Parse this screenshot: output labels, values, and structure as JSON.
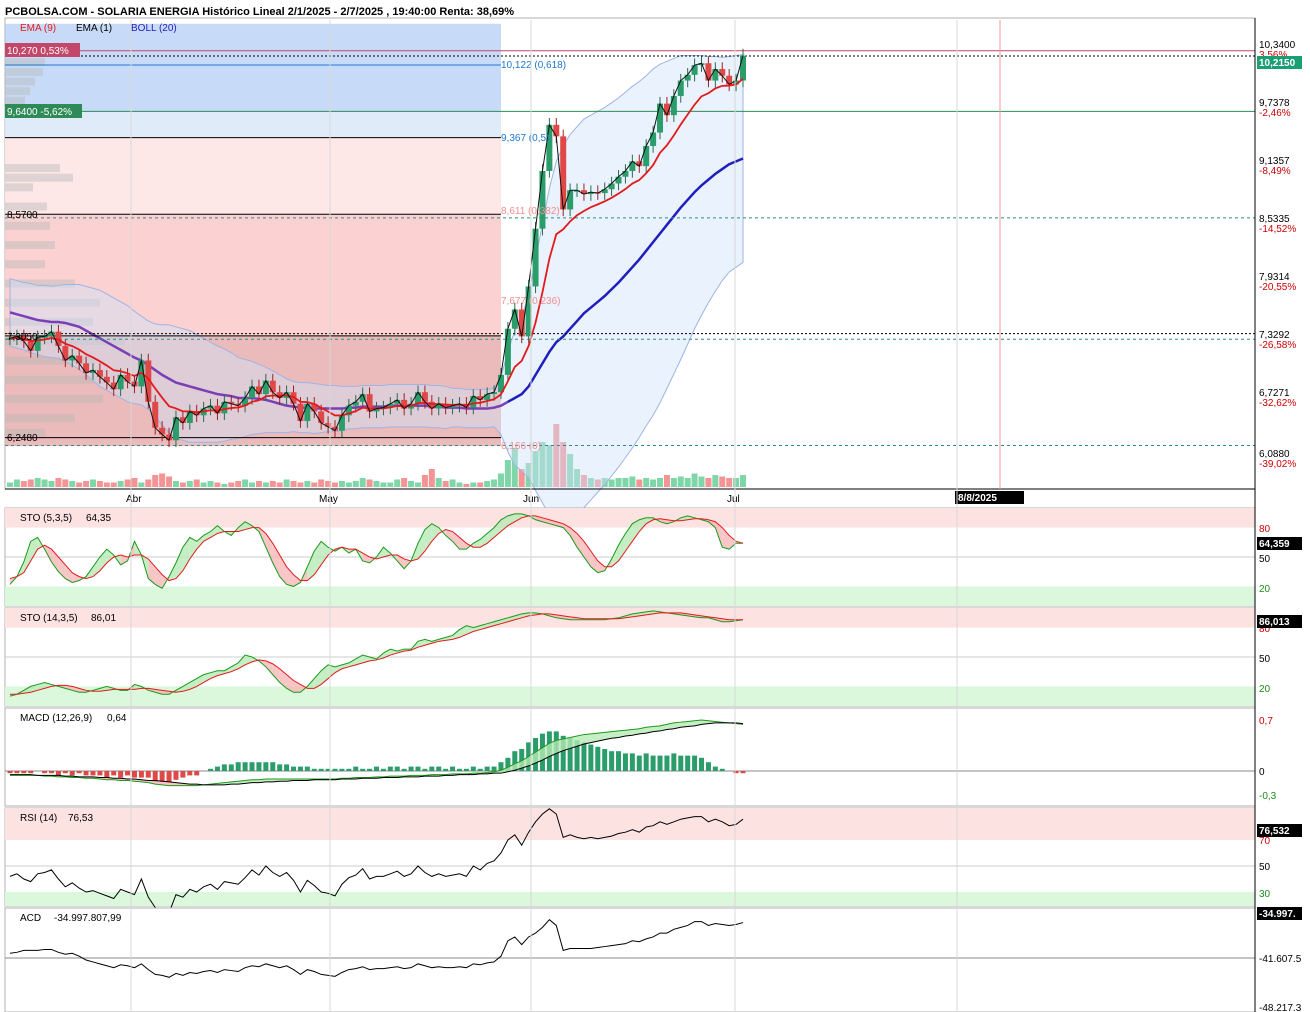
{
  "header": {
    "title": "PCBOLSA.COM - SOLARIA ENERGIA Histórico Lineal 2/1/2025 - 2/7/2025 , 19:40:00 Renta: 38,69%"
  },
  "legend": [
    {
      "label": "EMA (9)",
      "color": "#e31a1c"
    },
    {
      "label": "EMA (1)",
      "color": "#000000"
    },
    {
      "label": "BOLL (20)",
      "color": "#1f1fbf"
    }
  ],
  "price_axis": {
    "ticks": [
      {
        "value": "10,3400",
        "pct": "3,56%"
      },
      {
        "value": "9,7378",
        "pct": "-2,46%"
      },
      {
        "value": "9,1357",
        "pct": "-8,49%"
      },
      {
        "value": "8,5335",
        "pct": "-14,52%"
      },
      {
        "value": "7,9314",
        "pct": "-20,55%"
      },
      {
        "value": "7,3292",
        "pct": "-26,58%"
      },
      {
        "value": "6,7271",
        "pct": "-32,62%"
      },
      {
        "value": "6,0880",
        "pct": "-39,02%"
      }
    ],
    "current_price": "10,2150"
  },
  "left_labels": {
    "high_box": "10,270  0,53%",
    "low_box": "9,6400  -5,62%",
    "level_1": "8,5700",
    "level_2": "7,3050",
    "level_3": "6,2480"
  },
  "fibonacci": [
    {
      "label": "10,122 (0,618)",
      "color": "#1f77d0"
    },
    {
      "label": "9,367 (0,5)",
      "color": "#1f77d0"
    },
    {
      "label": "8,611 (0,382)",
      "color": "#f28e8e"
    },
    {
      "label": "7,677 (0,236)",
      "color": "#f28e8e"
    },
    {
      "label": "6,166 (0)",
      "color": "#f28e8e"
    }
  ],
  "x_axis": {
    "months": [
      "Abr",
      "May",
      "Jun",
      "Jul"
    ],
    "date_badge": "8/8/2025"
  },
  "panels": {
    "sto1": {
      "label": "STO (5,3,5)",
      "value": "64,35",
      "badge": "64,359",
      "ticks": [
        "80",
        "50",
        "20"
      ]
    },
    "sto2": {
      "label": "STO (14,3,5)",
      "value": "86,01",
      "badge": "86,013",
      "ticks": [
        "80",
        "50",
        "20"
      ]
    },
    "macd": {
      "label": "MACD (12,26,9)",
      "value": "0,64",
      "ticks": [
        "0,7",
        "0",
        "-0,3"
      ]
    },
    "rsi": {
      "label": "RSI (14)",
      "value": "76,53",
      "badge": "76,532",
      "ticks": [
        "70",
        "50",
        "30"
      ]
    },
    "acd": {
      "label": "ACD",
      "value": "-34.997.807,99",
      "badge": "-34.997.",
      "ticks": [
        "-41.607.5",
        "-48.217.3"
      ]
    }
  },
  "chart_data": {
    "type": "candlestick",
    "ylim": [
      6.05,
      10.45
    ],
    "close": [
      7.28,
      7.3,
      7.25,
      7.15,
      7.29,
      7.3,
      7.35,
      7.2,
      7.05,
      7.1,
      7.02,
      6.92,
      6.95,
      6.88,
      6.82,
      6.75,
      6.9,
      6.83,
      6.78,
      7.05,
      6.62,
      6.35,
      6.28,
      6.22,
      6.46,
      6.4,
      6.52,
      6.48,
      6.55,
      6.58,
      6.5,
      6.62,
      6.6,
      6.58,
      6.66,
      6.78,
      6.7,
      6.84,
      6.72,
      6.66,
      6.72,
      6.6,
      6.42,
      6.6,
      6.52,
      6.4,
      6.36,
      6.32,
      6.48,
      6.58,
      6.62,
      6.7,
      6.52,
      6.55,
      6.56,
      6.6,
      6.64,
      6.55,
      6.6,
      6.72,
      6.62,
      6.55,
      6.6,
      6.56,
      6.58,
      6.6,
      6.56,
      6.68,
      6.64,
      6.7,
      6.72,
      6.9,
      7.38,
      7.58,
      7.3,
      7.82,
      8.42,
      9.02,
      9.5,
      9.38,
      8.62,
      8.82,
      8.82,
      8.78,
      8.8,
      8.79,
      8.83,
      8.89,
      8.96,
      9.02,
      9.12,
      9.07,
      9.28,
      9.42,
      9.72,
      9.6,
      9.8,
      9.96,
      10.02,
      10.12,
      10.14,
      9.96,
      10.08,
      10.01,
      9.92,
      9.96,
      10.22
    ],
    "ema9_start": 7.28,
    "boll_mid": [
      7.55,
      7.53,
      7.51,
      7.49,
      7.47,
      7.46,
      7.45,
      7.45,
      7.44,
      7.42,
      7.4,
      7.36,
      7.32,
      7.28,
      7.24,
      7.2,
      7.16,
      7.12,
      7.08,
      7.05,
      7.0,
      6.95,
      6.9,
      6.86,
      6.82,
      6.8,
      6.78,
      6.76,
      6.74,
      6.72,
      6.7,
      6.69,
      6.68,
      6.66,
      6.66,
      6.66,
      6.65,
      6.64,
      6.62,
      6.6,
      6.58,
      6.57,
      6.56,
      6.56,
      6.55,
      6.55,
      6.55,
      6.55,
      6.55,
      6.56,
      6.56,
      6.57,
      6.57,
      6.57,
      6.57,
      6.58,
      6.58,
      6.58,
      6.58,
      6.58,
      6.58,
      6.57,
      6.57,
      6.56,
      6.56,
      6.56,
      6.55,
      6.55,
      6.55,
      6.55,
      6.56,
      6.58,
      6.62,
      6.66,
      6.7,
      6.78,
      6.9,
      7.02,
      7.14,
      7.24,
      7.3,
      7.38,
      7.46,
      7.54,
      7.6,
      7.66,
      7.72,
      7.79,
      7.86,
      7.94,
      8.02,
      8.1,
      8.19,
      8.28,
      8.37,
      8.46,
      8.55,
      8.64,
      8.72,
      8.8,
      8.87,
      8.93,
      8.99,
      9.04,
      9.09,
      9.12,
      9.15
    ],
    "boll_width": [
      0.35,
      0.35,
      0.35,
      0.36,
      0.36,
      0.37,
      0.37,
      0.38,
      0.4,
      0.42,
      0.44,
      0.46,
      0.48,
      0.5,
      0.5,
      0.5,
      0.5,
      0.5,
      0.48,
      0.46,
      0.46,
      0.48,
      0.52,
      0.56,
      0.58,
      0.58,
      0.58,
      0.56,
      0.54,
      0.52,
      0.5,
      0.48,
      0.45,
      0.42,
      0.4,
      0.38,
      0.36,
      0.34,
      0.32,
      0.3,
      0.28,
      0.26,
      0.26,
      0.26,
      0.26,
      0.25,
      0.24,
      0.24,
      0.23,
      0.22,
      0.22,
      0.22,
      0.22,
      0.22,
      0.22,
      0.22,
      0.22,
      0.22,
      0.22,
      0.22,
      0.22,
      0.22,
      0.22,
      0.22,
      0.2,
      0.2,
      0.2,
      0.2,
      0.2,
      0.2,
      0.2,
      0.3,
      0.52,
      0.7,
      0.8,
      0.95,
      1.2,
      1.45,
      1.7,
      1.88,
      1.98,
      2.02,
      2.02,
      2.02,
      2.0,
      1.98,
      1.96,
      1.94,
      1.92,
      1.9,
      1.88,
      1.85,
      1.82,
      1.8,
      1.76,
      1.7,
      1.64,
      1.58,
      1.5,
      1.42,
      1.35,
      1.28,
      1.22,
      1.16,
      1.12,
      1.1,
      1.08
    ],
    "volume": [
      3,
      5,
      4,
      5,
      6,
      5,
      4,
      6,
      5,
      4,
      3,
      4,
      5,
      4,
      3,
      3,
      4,
      5,
      6,
      3,
      5,
      8,
      9,
      7,
      4,
      3,
      4,
      5,
      3,
      4,
      3,
      2,
      3,
      4,
      5,
      3,
      4,
      3,
      4,
      3,
      5,
      4,
      3,
      4,
      3,
      5,
      4,
      3,
      4,
      3,
      4,
      6,
      5,
      4,
      3,
      3,
      5,
      6,
      4,
      3,
      8,
      12,
      6,
      4,
      5,
      3,
      2,
      3,
      3,
      4,
      5,
      9,
      18,
      26,
      12,
      16,
      24,
      30,
      28,
      42,
      30,
      22,
      12,
      8,
      6,
      5,
      6,
      5,
      6,
      6,
      7,
      5,
      6,
      5,
      6,
      8,
      6,
      7,
      6,
      9,
      7,
      6,
      8,
      7,
      6,
      6,
      8
    ],
    "sto1_k": [
      22,
      30,
      45,
      66,
      70,
      58,
      45,
      35,
      28,
      24,
      26,
      30,
      40,
      50,
      58,
      52,
      42,
      46,
      66,
      52,
      28,
      22,
      18,
      30,
      44,
      60,
      70,
      66,
      72,
      76,
      82,
      76,
      72,
      80,
      86,
      82,
      76,
      60,
      44,
      30,
      22,
      20,
      24,
      40,
      56,
      66,
      60,
      56,
      60,
      54,
      58,
      46,
      44,
      50,
      60,
      54,
      46,
      38,
      46,
      64,
      78,
      84,
      80,
      72,
      66,
      58,
      58,
      64,
      68,
      74,
      80,
      88,
      92,
      94,
      94,
      92,
      88,
      86,
      84,
      82,
      80,
      72,
      60,
      50,
      40,
      34,
      36,
      48,
      62,
      74,
      84,
      88,
      90,
      90,
      86,
      84,
      86,
      90,
      92,
      90,
      88,
      86,
      80,
      60,
      58,
      64,
      64
    ],
    "sto1_d": [
      28,
      30,
      34,
      46,
      58,
      62,
      58,
      50,
      42,
      34,
      30,
      28,
      30,
      36,
      44,
      50,
      52,
      50,
      52,
      52,
      48,
      40,
      32,
      26,
      28,
      36,
      48,
      58,
      66,
      70,
      74,
      76,
      76,
      76,
      78,
      80,
      80,
      74,
      64,
      52,
      40,
      32,
      26,
      26,
      32,
      42,
      52,
      58,
      60,
      58,
      58,
      54,
      50,
      48,
      50,
      52,
      52,
      48,
      46,
      48,
      56,
      66,
      74,
      78,
      76,
      70,
      64,
      60,
      60,
      64,
      70,
      76,
      82,
      86,
      90,
      92,
      92,
      90,
      88,
      86,
      84,
      80,
      74,
      66,
      56,
      46,
      40,
      40,
      46,
      56,
      66,
      76,
      84,
      88,
      89,
      88,
      87,
      87,
      88,
      89,
      89,
      88,
      86,
      80,
      72,
      66,
      64
    ],
    "sto2_k": [
      10,
      12,
      16,
      20,
      22,
      24,
      22,
      20,
      18,
      16,
      14,
      14,
      16,
      18,
      20,
      18,
      16,
      16,
      22,
      20,
      16,
      14,
      12,
      12,
      16,
      20,
      24,
      28,
      32,
      34,
      36,
      36,
      40,
      44,
      52,
      50,
      46,
      40,
      32,
      24,
      18,
      14,
      14,
      20,
      28,
      36,
      42,
      40,
      42,
      44,
      48,
      52,
      50,
      48,
      54,
      58,
      56,
      58,
      58,
      66,
      68,
      66,
      68,
      70,
      72,
      78,
      82,
      80,
      82,
      84,
      86,
      88,
      90,
      92,
      94,
      95,
      95,
      94,
      92,
      90,
      89,
      88,
      88,
      88,
      88,
      88,
      88,
      89,
      90,
      92,
      94,
      95,
      96,
      97,
      96,
      95,
      94,
      93,
      92,
      91,
      90,
      90,
      88,
      86,
      86,
      87,
      88
    ],
    "sto2_d": [
      12,
      12,
      13,
      14,
      16,
      18,
      20,
      21,
      21,
      20,
      18,
      16,
      15,
      15,
      16,
      17,
      17,
      17,
      17,
      18,
      18,
      17,
      16,
      15,
      14,
      15,
      17,
      20,
      24,
      28,
      31,
      33,
      35,
      38,
      42,
      45,
      47,
      46,
      43,
      38,
      32,
      26,
      22,
      18,
      18,
      22,
      28,
      34,
      38,
      40,
      42,
      44,
      46,
      47,
      49,
      52,
      54,
      56,
      57,
      60,
      62,
      64,
      66,
      67,
      68,
      70,
      73,
      76,
      78,
      80,
      82,
      84,
      86,
      88,
      90,
      92,
      93,
      94,
      94,
      93,
      92,
      91,
      90,
      89,
      89,
      89,
      89,
      89,
      89,
      90,
      91,
      92,
      93,
      94,
      95,
      95,
      95,
      95,
      94,
      93,
      92,
      91,
      90,
      89,
      88,
      88,
      88
    ],
    "macd_line": [
      -0.06,
      -0.06,
      -0.06,
      -0.06,
      -0.06,
      -0.07,
      -0.07,
      -0.08,
      -0.08,
      -0.09,
      -0.09,
      -0.1,
      -0.1,
      -0.11,
      -0.12,
      -0.12,
      -0.13,
      -0.13,
      -0.14,
      -0.15,
      -0.16,
      -0.18,
      -0.19,
      -0.2,
      -0.2,
      -0.2,
      -0.2,
      -0.2,
      -0.19,
      -0.18,
      -0.17,
      -0.16,
      -0.15,
      -0.14,
      -0.13,
      -0.12,
      -0.12,
      -0.11,
      -0.11,
      -0.11,
      -0.11,
      -0.11,
      -0.11,
      -0.11,
      -0.11,
      -0.11,
      -0.11,
      -0.11,
      -0.1,
      -0.1,
      -0.09,
      -0.09,
      -0.09,
      -0.08,
      -0.08,
      -0.07,
      -0.07,
      -0.07,
      -0.06,
      -0.06,
      -0.06,
      -0.05,
      -0.05,
      -0.05,
      -0.04,
      -0.04,
      -0.04,
      -0.03,
      -0.03,
      -0.02,
      -0.01,
      0.01,
      0.05,
      0.1,
      0.14,
      0.2,
      0.26,
      0.32,
      0.38,
      0.42,
      0.44,
      0.46,
      0.48,
      0.5,
      0.51,
      0.52,
      0.53,
      0.54,
      0.55,
      0.56,
      0.57,
      0.58,
      0.6,
      0.61,
      0.62,
      0.64,
      0.66,
      0.67,
      0.68,
      0.69,
      0.7,
      0.69,
      0.68,
      0.67,
      0.66,
      0.65,
      0.64
    ],
    "macd_signal": [
      -0.05,
      -0.05,
      -0.05,
      -0.05,
      -0.06,
      -0.06,
      -0.06,
      -0.06,
      -0.07,
      -0.07,
      -0.08,
      -0.08,
      -0.08,
      -0.09,
      -0.09,
      -0.1,
      -0.1,
      -0.11,
      -0.11,
      -0.12,
      -0.13,
      -0.13,
      -0.14,
      -0.15,
      -0.16,
      -0.17,
      -0.18,
      -0.18,
      -0.19,
      -0.19,
      -0.19,
      -0.19,
      -0.18,
      -0.18,
      -0.17,
      -0.16,
      -0.16,
      -0.15,
      -0.15,
      -0.14,
      -0.14,
      -0.13,
      -0.13,
      -0.13,
      -0.12,
      -0.12,
      -0.12,
      -0.12,
      -0.11,
      -0.11,
      -0.11,
      -0.1,
      -0.1,
      -0.1,
      -0.09,
      -0.09,
      -0.09,
      -0.08,
      -0.08,
      -0.08,
      -0.07,
      -0.07,
      -0.07,
      -0.06,
      -0.06,
      -0.05,
      -0.05,
      -0.05,
      -0.04,
      -0.04,
      -0.03,
      -0.03,
      -0.01,
      0.01,
      0.04,
      0.07,
      0.11,
      0.15,
      0.2,
      0.24,
      0.28,
      0.31,
      0.34,
      0.37,
      0.39,
      0.41,
      0.43,
      0.45,
      0.46,
      0.48,
      0.49,
      0.51,
      0.52,
      0.54,
      0.55,
      0.57,
      0.58,
      0.6,
      0.61,
      0.62,
      0.64,
      0.65,
      0.66,
      0.66,
      0.66,
      0.66,
      0.65
    ],
    "rsi": [
      42,
      44,
      40,
      38,
      44,
      45,
      47,
      40,
      34,
      37,
      33,
      30,
      31,
      29,
      27,
      25,
      32,
      30,
      28,
      40,
      26,
      18,
      16,
      14,
      28,
      26,
      32,
      30,
      34,
      36,
      32,
      38,
      37,
      36,
      41,
      47,
      43,
      50,
      45,
      42,
      45,
      39,
      30,
      39,
      35,
      30,
      29,
      27,
      36,
      41,
      43,
      48,
      40,
      42,
      42,
      44,
      46,
      42,
      44,
      50,
      45,
      42,
      44,
      42,
      43,
      44,
      42,
      50,
      47,
      52,
      54,
      60,
      70,
      74,
      66,
      76,
      84,
      90,
      94,
      90,
      72,
      74,
      72,
      71,
      72,
      71,
      72,
      73,
      75,
      76,
      78,
      76,
      80,
      81,
      84,
      82,
      84,
      86,
      87,
      88,
      88,
      84,
      86,
      84,
      81,
      82,
      86
    ],
    "acd": [
      57,
      58,
      60,
      60,
      60,
      61,
      61,
      58,
      56,
      57,
      54,
      50,
      48,
      46,
      44,
      42,
      45,
      44,
      42,
      46,
      40,
      35,
      34,
      32,
      36,
      34,
      37,
      36,
      38,
      39,
      37,
      40,
      39,
      38,
      42,
      44,
      43,
      46,
      44,
      42,
      44,
      40,
      35,
      40,
      38,
      35,
      34,
      33,
      37,
      40,
      41,
      43,
      40,
      41,
      41,
      42,
      43,
      41,
      42,
      46,
      44,
      42,
      43,
      42,
      42,
      43,
      42,
      46,
      45,
      47,
      48,
      54,
      70,
      74,
      66,
      74,
      78,
      84,
      92,
      86,
      60,
      62,
      62,
      62,
      62,
      63,
      64,
      65,
      66,
      67,
      70,
      69,
      72,
      74,
      78,
      78,
      82,
      84,
      86,
      90,
      90,
      86,
      88,
      87,
      86,
      87,
      89
    ]
  }
}
